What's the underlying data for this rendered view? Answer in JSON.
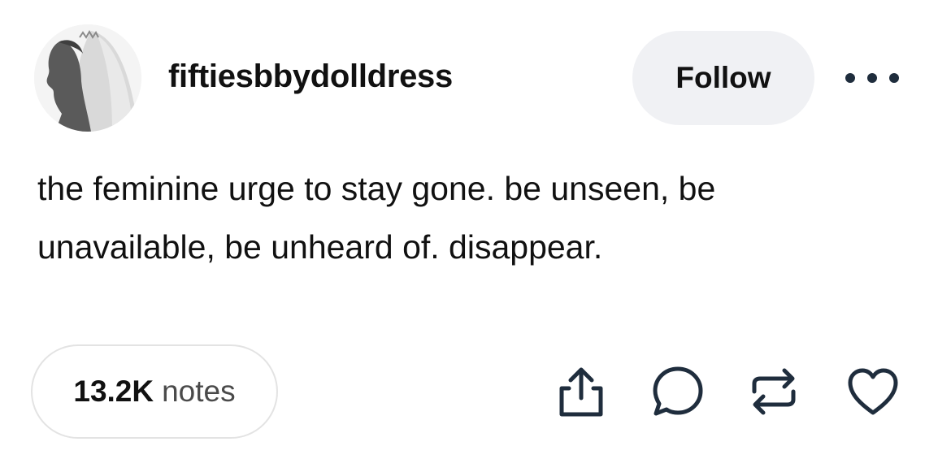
{
  "post": {
    "username": "fiftiesbbydolldress",
    "follow_label": "Follow",
    "text": "the feminine urge to stay gone. be unseen, be\nunavailable, be unheard of. disappear.",
    "notes_count": "13.2K",
    "notes_label": "notes"
  },
  "icons": {
    "more": "more-options-icon",
    "share": "share-icon",
    "reply": "reply-icon",
    "reblog": "reblog-icon",
    "like": "heart-icon"
  },
  "colors": {
    "icon": "#1f2d3d",
    "follow_bg": "#f0f1f4",
    "pill_border": "#e3e3e3"
  }
}
